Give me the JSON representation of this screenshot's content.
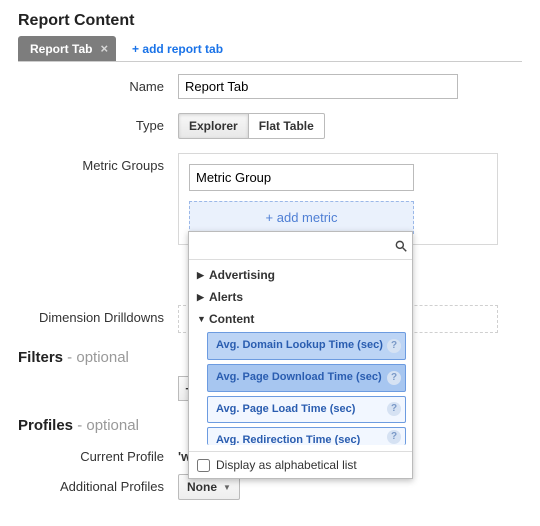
{
  "header": {
    "title": "Report Content"
  },
  "tabs": {
    "active_label": "Report Tab",
    "add_label": "+ add report tab"
  },
  "form": {
    "name_label": "Name",
    "name_value": "Report Tab",
    "type_label": "Type",
    "type_options": {
      "explorer": "Explorer",
      "flat_table": "Flat Table"
    },
    "metric_groups_label": "Metric Groups",
    "metric_group_name": "Metric Group",
    "add_metric_label": "+ add metric",
    "dimension_label": "Dimension Drilldowns"
  },
  "dropdown": {
    "categories": [
      {
        "label": "Advertising",
        "expanded": false
      },
      {
        "label": "Alerts",
        "expanded": false
      },
      {
        "label": "Content",
        "expanded": true
      }
    ],
    "content_items": [
      "Avg. Domain Lookup Time (sec)",
      "Avg. Page Download Time (sec)",
      "Avg. Page Load Time (sec)",
      "Avg. Redirection Time (sec)"
    ],
    "footer_label": "Display as alphabetical list"
  },
  "filters": {
    "title": "Filters",
    "optional": " - optional",
    "plus": "+"
  },
  "profiles": {
    "title": "Profiles",
    "optional": " - optional",
    "current_label": "Current Profile",
    "current_value": "'w",
    "additional_label": "Additional Profiles",
    "additional_value": "None"
  }
}
